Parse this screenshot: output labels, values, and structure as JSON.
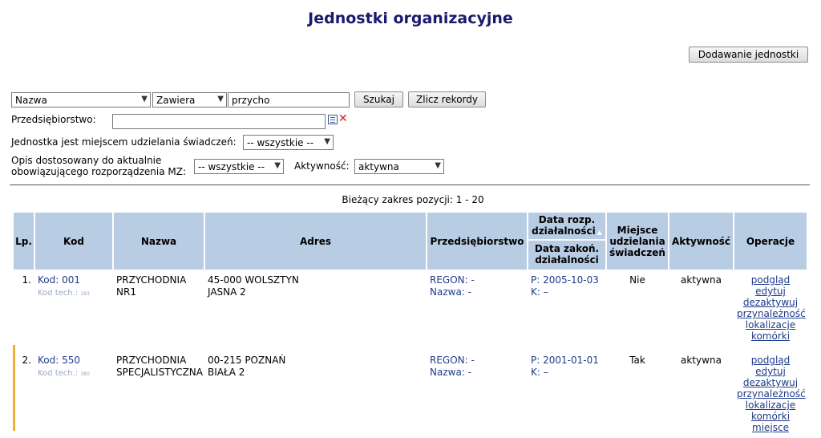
{
  "page": {
    "title": "Jednostki organizacyjne"
  },
  "toolbar": {
    "add_label": "Dodawanie jednostki"
  },
  "search": {
    "field": "Nazwa",
    "operator": "Zawiera",
    "value": "przycho",
    "search_label": "Szukaj",
    "count_label": "Zlicz rekordy"
  },
  "filters": {
    "company_label": "Przedsiębiorstwo:",
    "company_value": "",
    "place_label": "Jednostka jest miejscem udzielania świadczeń:",
    "place_value": "-- wszystkie --",
    "desc_label_1": "Opis dostosowany do aktualnie",
    "desc_label_2": "obowiązującego rozporządzenia MZ:",
    "desc_value": "-- wszystkie --",
    "active_label": "Aktywność:",
    "active_value": "aktywna"
  },
  "range_text": "Bieżący zakres pozycji: 1 - 20",
  "table": {
    "headers": {
      "lp": "Lp.",
      "kod": "Kod",
      "nazwa": "Nazwa",
      "adres": "Adres",
      "przeds": "Przedsiębiorstwo",
      "start_1": "Data rozp.",
      "start_2": "działalności",
      "end_1": "Data zakoń.",
      "end_2": "działalności",
      "place_1": "Miejsce",
      "place_2": "udzielania",
      "place_3": "świadczeń",
      "active": "Aktywność",
      "ops": "Operacje"
    },
    "rows": [
      {
        "lp": "1.",
        "kod": "Kod: 001",
        "kod_tech": "Kod tech.: ",
        "kod_tech_num": "183",
        "name_1": "PRZYCHODNIA",
        "name_2": "NR1",
        "addr_1": "45-000 WOLSZTYN",
        "addr_2": "JASNA 2",
        "regon": "REGON: -",
        "nazwa": "Nazwa: -",
        "p": "P: 2005-10-03",
        "k": "K: –",
        "place": "Nie",
        "active": "aktywna",
        "ops": [
          "podgląd",
          "edytuj",
          "dezaktywuj",
          "przynależność",
          "lokalizacje",
          "komórki"
        ]
      },
      {
        "lp": "2.",
        "kod": "Kod: 550",
        "kod_tech": "Kod tech.: ",
        "kod_tech_num": "380",
        "name_1": "PRZYCHODNIA",
        "name_2": "SPECJALISTYCZNA",
        "addr_1": "00-215 POZNAŃ",
        "addr_2": "BIAŁA 2",
        "regon": "REGON: -",
        "nazwa": "Nazwa: -",
        "p": "P: 2001-01-01",
        "k": "K: –",
        "place": "Tak",
        "active": "aktywna",
        "ops": [
          "podgląd",
          "edytuj",
          "dezaktywuj",
          "przynależność",
          "lokalizacje",
          "komórki",
          "miejsce"
        ]
      }
    ]
  }
}
